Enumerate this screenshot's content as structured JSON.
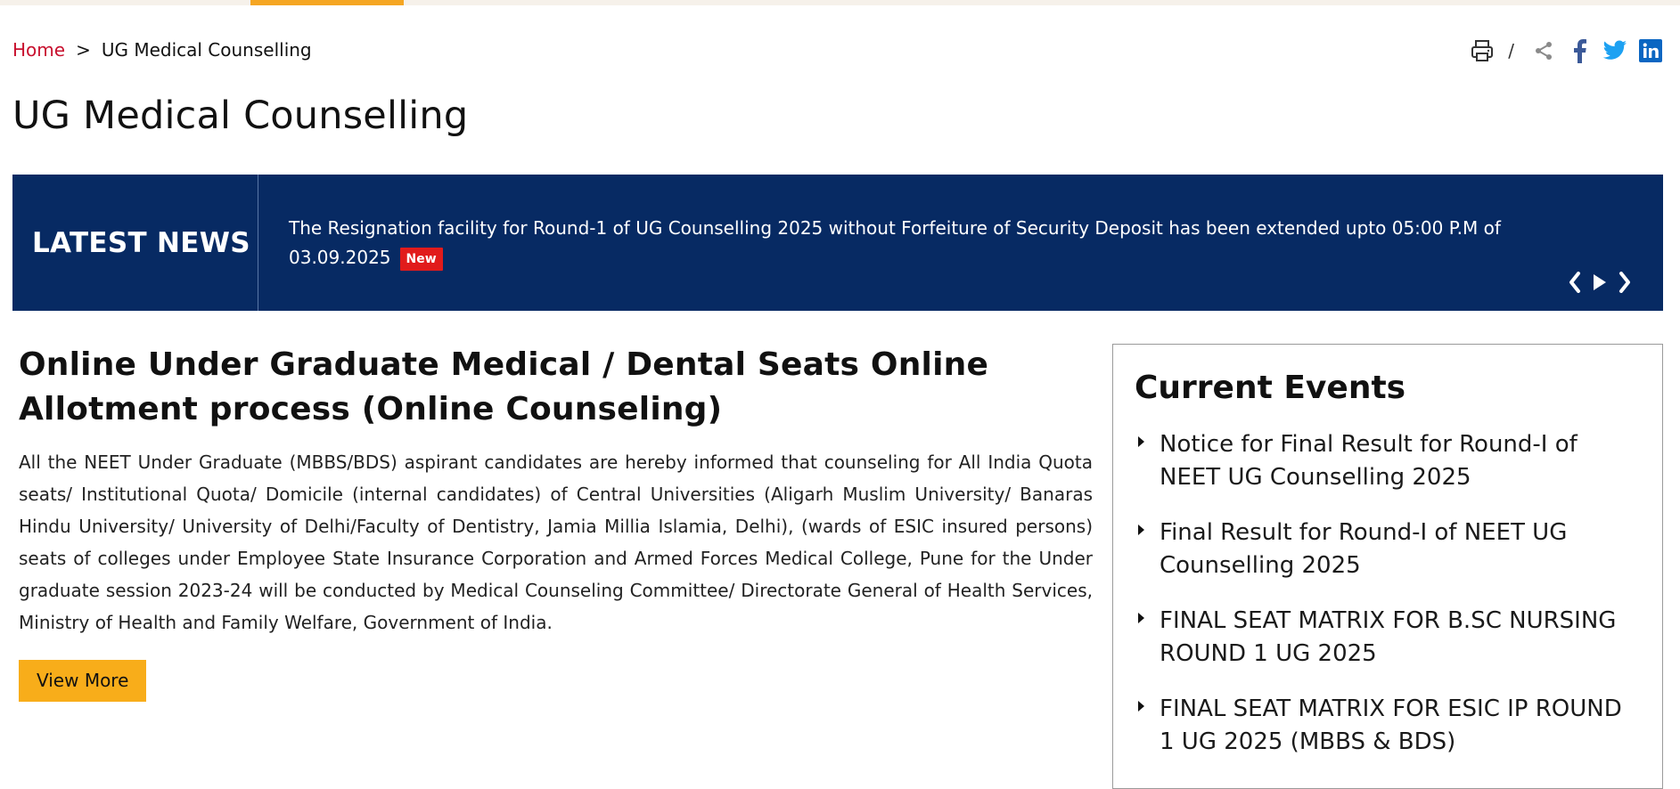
{
  "breadcrumb": {
    "home": "Home",
    "separator": ">",
    "current": "UG Medical Counselling"
  },
  "tools": {
    "slash": "/",
    "icons": [
      "print-icon",
      "share-icon",
      "facebook-icon",
      "twitter-icon",
      "linkedin-icon"
    ]
  },
  "page_title": "UG Medical Counselling",
  "news": {
    "label": "LATEST NEWS",
    "text": "The Resignation facility for Round-1 of UG Counselling 2025 without Forfeiture of Security Deposit has been extended upto 05:00 P.M of 03.09.2025",
    "badge": "New",
    "controls": [
      "chevron-left-icon",
      "play-icon",
      "chevron-right-icon"
    ]
  },
  "main": {
    "title": "Online Under Graduate Medical / Dental Seats Online Allotment process (Online Counseling)",
    "body": "All the NEET Under Graduate (MBBS/BDS) aspirant candidates are hereby informed that counseling for All India Quota seats/ Institutional Quota/ Domicile (internal candidates) of Central Universities (Aligarh Muslim University/ Banaras Hindu University/ University of Delhi/Faculty of Dentistry, Jamia Millia Islamia, Delhi), (wards of ESIC insured persons) seats of colleges under Employee State Insurance Corporation and Armed Forces Medical College, Pune for the Under graduate session 2023-24 will be conducted by Medical Counseling Committee/ Directorate General of Health Services, Ministry of Health and Family Welfare, Government of India.",
    "view_more": "View More"
  },
  "events": {
    "title": "Current Events",
    "items": [
      "Notice for Final Result for Round-I of NEET UG Counselling 2025",
      "Final Result for Round-I of NEET UG Counselling 2025",
      "FINAL SEAT MATRIX FOR B.SC NURSING ROUND 1 UG 2025",
      "FINAL SEAT MATRIX FOR ESIC IP ROUND 1 UG 2025 (MBBS & BDS)"
    ]
  },
  "colors": {
    "accent": "#f5a623",
    "news_bg": "#072a63",
    "link_red": "#c8102e",
    "badge_red": "#e11b1b",
    "facebook": "#3b5998",
    "twitter": "#1da1f2",
    "linkedin": "#0a66c2"
  }
}
